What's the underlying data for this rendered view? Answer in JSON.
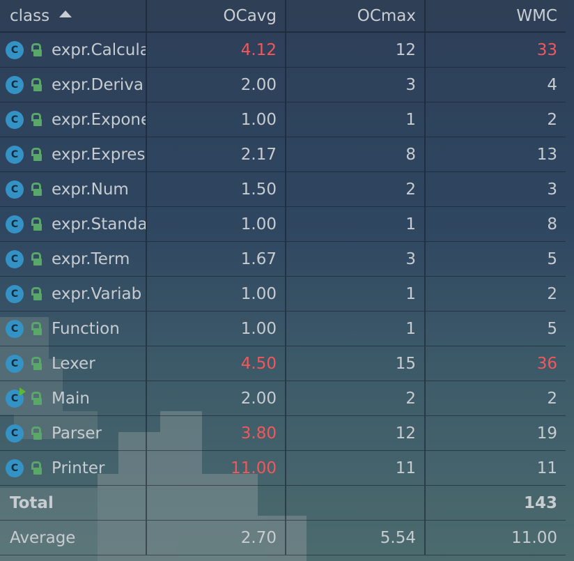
{
  "columns": {
    "class": "class",
    "ocavg": "OCavg",
    "ocmax": "OCmax",
    "wmc": "WMC"
  },
  "rows": [
    {
      "name": "expr.Calcula",
      "ocavg": "4.12",
      "ocmax": "12",
      "wmc": "33",
      "ocavg_hot": true,
      "wmc_hot": true,
      "main": false
    },
    {
      "name": "expr.Deriva",
      "ocavg": "2.00",
      "ocmax": "3",
      "wmc": "4",
      "ocavg_hot": false,
      "wmc_hot": false,
      "main": false
    },
    {
      "name": "expr.Expone",
      "ocavg": "1.00",
      "ocmax": "1",
      "wmc": "2",
      "ocavg_hot": false,
      "wmc_hot": false,
      "main": false
    },
    {
      "name": "expr.Expres",
      "ocavg": "2.17",
      "ocmax": "8",
      "wmc": "13",
      "ocavg_hot": false,
      "wmc_hot": false,
      "main": false
    },
    {
      "name": "expr.Num",
      "ocavg": "1.50",
      "ocmax": "2",
      "wmc": "3",
      "ocavg_hot": false,
      "wmc_hot": false,
      "main": false
    },
    {
      "name": "expr.Standa",
      "ocavg": "1.00",
      "ocmax": "1",
      "wmc": "8",
      "ocavg_hot": false,
      "wmc_hot": false,
      "main": false
    },
    {
      "name": "expr.Term",
      "ocavg": "1.67",
      "ocmax": "3",
      "wmc": "5",
      "ocavg_hot": false,
      "wmc_hot": false,
      "main": false
    },
    {
      "name": "expr.Variab",
      "ocavg": "1.00",
      "ocmax": "1",
      "wmc": "2",
      "ocavg_hot": false,
      "wmc_hot": false,
      "main": false
    },
    {
      "name": "Function",
      "ocavg": "1.00",
      "ocmax": "1",
      "wmc": "5",
      "ocavg_hot": false,
      "wmc_hot": false,
      "main": false
    },
    {
      "name": "Lexer",
      "ocavg": "4.50",
      "ocmax": "15",
      "wmc": "36",
      "ocavg_hot": true,
      "wmc_hot": true,
      "main": false
    },
    {
      "name": "Main",
      "ocavg": "2.00",
      "ocmax": "2",
      "wmc": "2",
      "ocavg_hot": false,
      "wmc_hot": false,
      "main": true
    },
    {
      "name": "Parser",
      "ocavg": "3.80",
      "ocmax": "12",
      "wmc": "19",
      "ocavg_hot": true,
      "wmc_hot": false,
      "main": false
    },
    {
      "name": "Printer",
      "ocavg": "11.00",
      "ocmax": "11",
      "wmc": "11",
      "ocavg_hot": true,
      "wmc_hot": false,
      "main": false
    }
  ],
  "total": {
    "label": "Total",
    "ocavg": "",
    "ocmax": "",
    "wmc": "143"
  },
  "average": {
    "label": "Average",
    "ocavg": "2.70",
    "ocmax": "5.54",
    "wmc": "11.00"
  },
  "icons": {
    "class": "class-icon",
    "access": "lock-open-icon",
    "sort": "sort-ascending-icon",
    "run": "run-gutter-icon"
  },
  "colors": {
    "hot": "#f2575c",
    "class_icon": "#3592c4",
    "lock": "#59a869",
    "text": "#c7ccd1"
  },
  "class_icon_letter": "C"
}
